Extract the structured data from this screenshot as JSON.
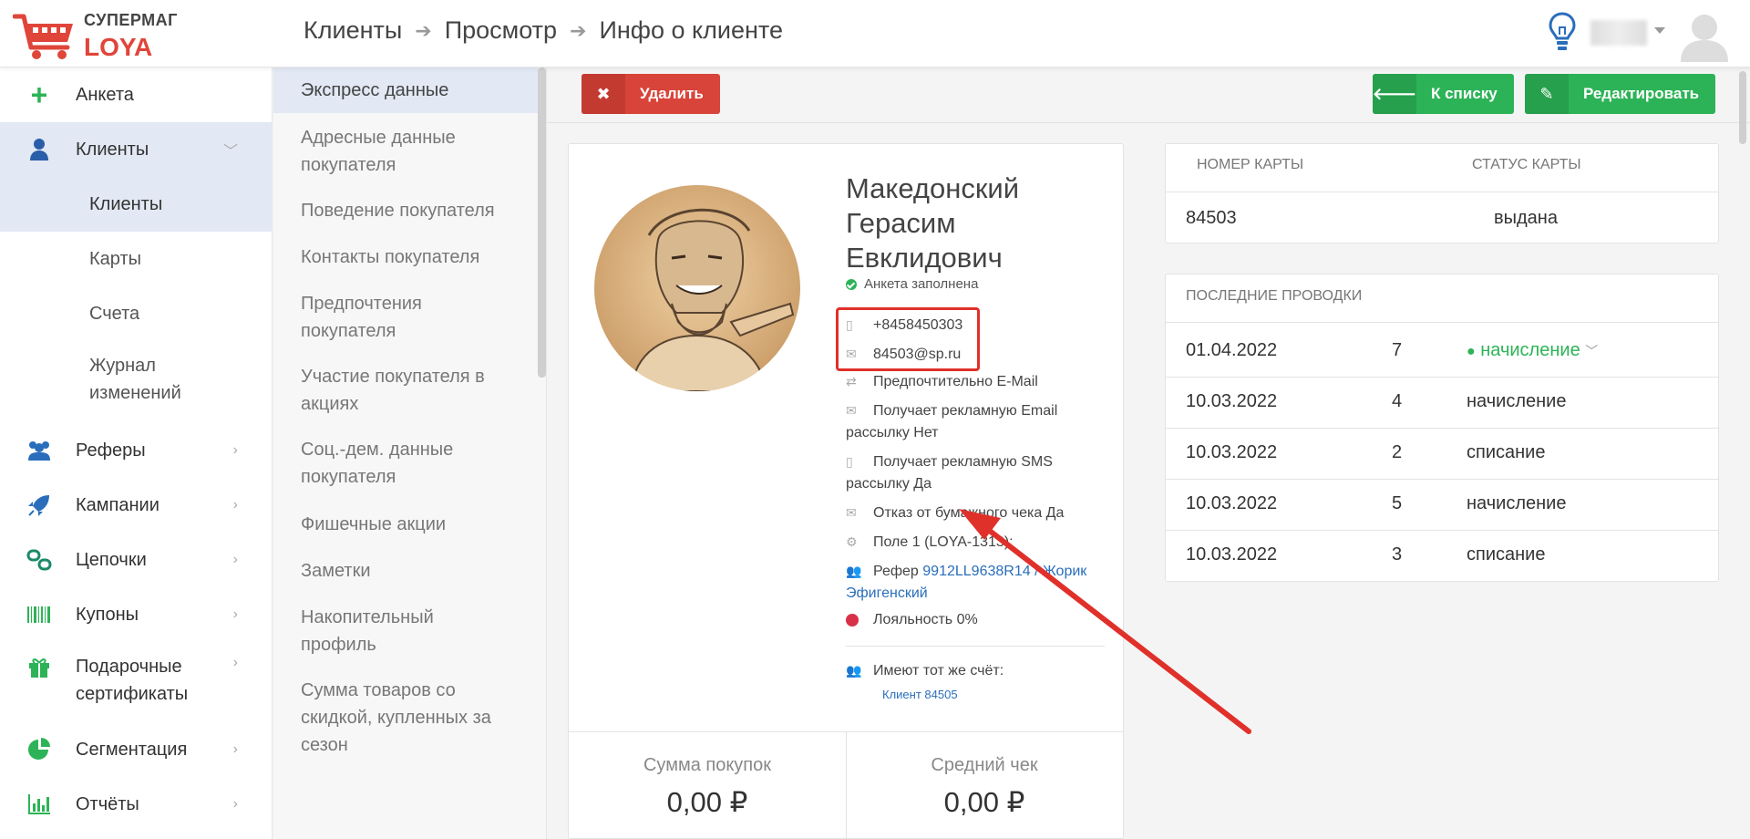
{
  "header": {
    "logo_top": "СУПЕРМАГ",
    "logo_bottom": "LOYA",
    "breadcrumbs": [
      "Клиенты",
      "Просмотр",
      "Инфо о клиенте"
    ]
  },
  "sidebar": {
    "items": [
      {
        "label": "Анкета",
        "icon": "plus-icon"
      },
      {
        "label": "Клиенты",
        "icon": "user-icon"
      },
      {
        "label": "Клиенты"
      },
      {
        "label": "Карты"
      },
      {
        "label": "Счета"
      },
      {
        "label": "Журнал изменений"
      },
      {
        "label": "Реферы",
        "icon": "users-icon"
      },
      {
        "label": "Кампании",
        "icon": "rocket-icon"
      },
      {
        "label": "Цепочки",
        "icon": "chain-icon"
      },
      {
        "label": "Купоны",
        "icon": "barcode-icon"
      },
      {
        "label": "Подарочные сертификаты",
        "icon": "gift-icon"
      },
      {
        "label": "Сегментация",
        "icon": "pie-icon"
      },
      {
        "label": "Отчёты",
        "icon": "bar-chart-icon"
      }
    ]
  },
  "section_menu": [
    "Экспресс данные",
    "Адресные данные покупателя",
    "Поведение покупателя",
    "Контакты покупателя",
    "Предпочтения покупателя",
    "Участие покупателя в акциях",
    "Соц.-дем. данные покупателя",
    "Фишечные акции",
    "Заметки",
    "Накопительный профиль",
    "Сумма товаров со скидкой, купленных за сезон"
  ],
  "toolbar": {
    "delete_label": "Удалить",
    "to_list_label": "К списку",
    "edit_label": "Редактировать"
  },
  "profile": {
    "name": "Македонский Герасим Евклидович",
    "status": "Анкета заполнена",
    "phone": "+8458450303",
    "email": "84503@sp.ru",
    "preferred": "Предпочтительно E-Mail",
    "email_ads": "Получает рекламную Email рассылку Нет",
    "sms_ads": "Получает рекламную SMS рассылку Да",
    "paper_receipt": "Отказ от бумажного чека Да",
    "field1": "Поле 1 (LOYA-1313):",
    "referrer_label": "Рефер",
    "referrer_link": "9912LL9638R14 / Жорик Эфигенский",
    "loyalty": "Лояльность 0%",
    "same_account_label": "Имеют тот же счёт:",
    "same_account_link": "Клиент 84505",
    "stats": [
      {
        "label": "Сумма покупок",
        "value": "0,00 ₽"
      },
      {
        "label": "Средний чек",
        "value": "0,00 ₽"
      }
    ]
  },
  "card_panel": {
    "headers": [
      "НОМЕР КАРТЫ",
      "СТАТУС КАРТЫ"
    ],
    "number": "84503",
    "status": "выдана"
  },
  "transactions": {
    "title": "ПОСЛЕДНИЕ ПРОВОДКИ",
    "rows": [
      {
        "date": "01.04.2022",
        "amount": "7",
        "type": "начисление"
      },
      {
        "date": "10.03.2022",
        "amount": "4",
        "type": "начисление"
      },
      {
        "date": "10.03.2022",
        "amount": "2",
        "type": "списание"
      },
      {
        "date": "10.03.2022",
        "amount": "5",
        "type": "начисление"
      },
      {
        "date": "10.03.2022",
        "amount": "3",
        "type": "списание"
      }
    ]
  },
  "colors": {
    "accent_red": "#d9443a",
    "accent_green": "#2db357",
    "highlight": "#e0302a"
  }
}
